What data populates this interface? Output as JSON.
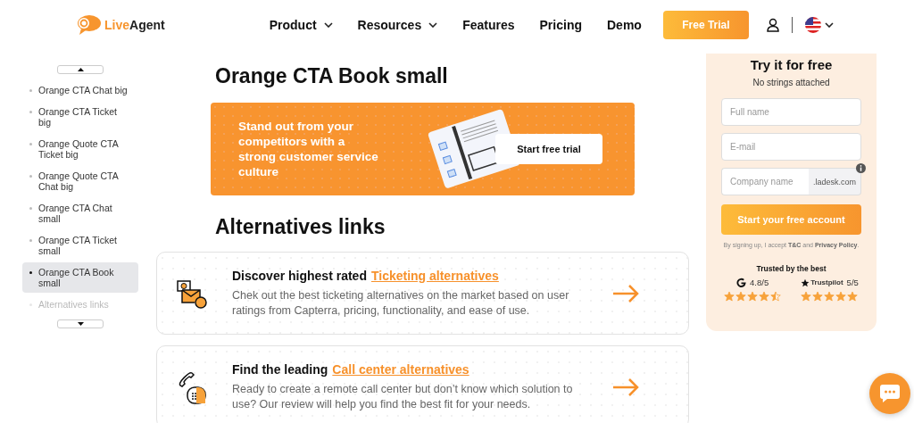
{
  "header": {
    "logo": "LiveAgent",
    "nav": [
      {
        "label": "Product",
        "dropdown": true
      },
      {
        "label": "Resources",
        "dropdown": true
      },
      {
        "label": "Features",
        "dropdown": false
      },
      {
        "label": "Pricing",
        "dropdown": false
      },
      {
        "label": "Demo",
        "dropdown": false
      }
    ],
    "cta": "Free Trial"
  },
  "sidebar": {
    "items": [
      {
        "label": "Orange CTA Chat big",
        "selected": false,
        "faded": false
      },
      {
        "label": "Orange CTA Ticket big",
        "selected": false,
        "faded": false
      },
      {
        "label": "Orange Quote CTA Ticket big",
        "selected": false,
        "faded": false
      },
      {
        "label": "Orange Quote CTA Chat big",
        "selected": false,
        "faded": false
      },
      {
        "label": "Orange CTA Chat small",
        "selected": false,
        "faded": false
      },
      {
        "label": "Orange CTA Ticket small",
        "selected": false,
        "faded": false
      },
      {
        "label": "Orange CTA Book small",
        "selected": true,
        "faded": false
      },
      {
        "label": "Alternatives links",
        "selected": false,
        "faded": true
      }
    ]
  },
  "main": {
    "heading": "Orange CTA Book small",
    "banner": {
      "text": "Stand out from your competitors with a strong customer service culture",
      "button": "Start free trial"
    },
    "section_heading": "Alternatives links",
    "cards": [
      {
        "kind": "ticket",
        "title": "Discover highest rated",
        "link": "Ticketing alternatives",
        "text": "Chek out the best ticketing alternatives on the market based on user ratings from Capterra, pricing, functionality, and ease of use."
      },
      {
        "kind": "phone",
        "title": "Find the leading",
        "link": "Call center alternatives",
        "text": "Ready to create a remote call center but don’t know which solution to use? Our review will help you find the best fit for your needs."
      }
    ]
  },
  "signup": {
    "title": "Try it for free",
    "subtitle": "No strings attached",
    "fields": [
      {
        "placeholder": "Full name"
      },
      {
        "placeholder": "E-mail"
      },
      {
        "placeholder": "Company name",
        "suffix": ".ladesk.com"
      }
    ],
    "button": "Start your free account",
    "legal": "By signing up, I accept **T&C** and **Privacy Policy**.",
    "trusted": "Trusted by the best",
    "ratings": [
      {
        "kind": "g2",
        "score": "4.8/5",
        "stars": 4.5
      },
      {
        "kind": "trustpilot",
        "brand": "Trustpilot",
        "score": "5/5",
        "stars": 5
      }
    ]
  }
}
